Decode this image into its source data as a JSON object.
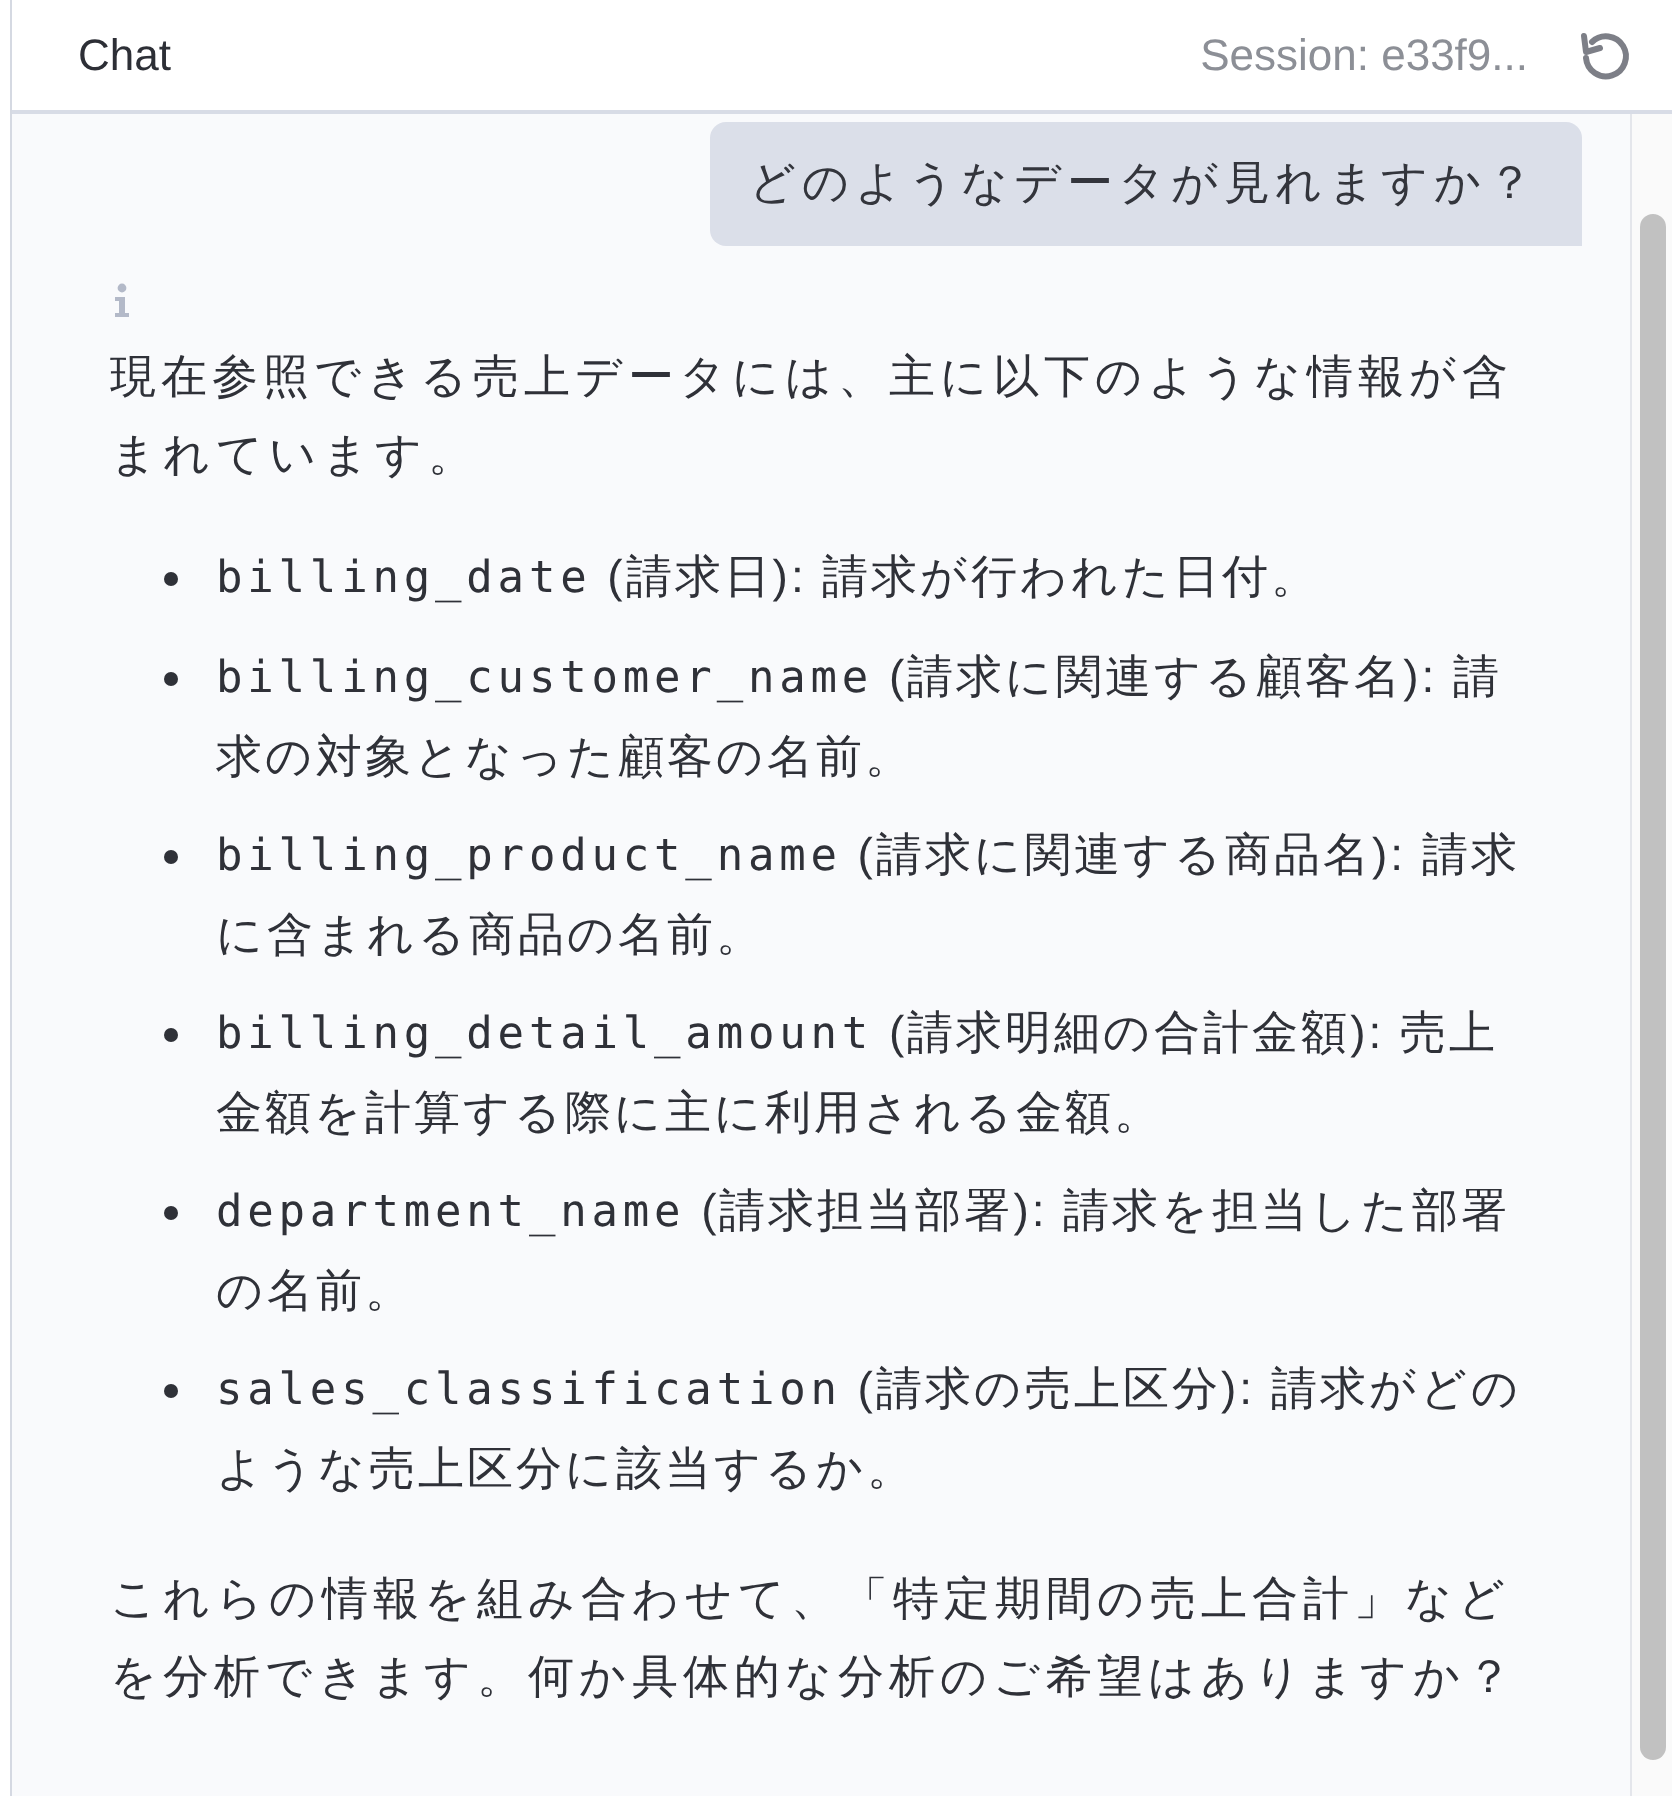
{
  "header": {
    "title": "Chat",
    "session": "Session: e33f9..."
  },
  "messages": [
    {
      "kind": "user",
      "text": "どのようなデータが見れますか？"
    },
    {
      "kind": "assistant",
      "intro": "現在参照できる売上データには、主に以下のような情報が含まれています。",
      "items": [
        {
          "field": "billing_date",
          "text": "(請求日): 請求が行われた日付。"
        },
        {
          "field": "billing_customer_name",
          "text": "(請求に関連する顧客名): 請求の対象となった顧客の名前。"
        },
        {
          "field": "billing_product_name",
          "text": "(請求に関連する商品名): 請求に含まれる商品の名前。"
        },
        {
          "field": "billing_detail_amount",
          "text": "(請求明細の合計金額): 売上金額を計算する際に主に利用される金額。"
        },
        {
          "field": "department_name",
          "text": "(請求担当部署): 請求を担当した部署の名前。"
        },
        {
          "field": "sales_classification",
          "text": "(請求の売上区分): 請求がどのような売上区分に該当するか。"
        }
      ],
      "outro": "これらの情報を組み合わせて、「特定期間の売上合計」などを分析できます。何か具体的な分析のご希望はありますか？"
    }
  ]
}
